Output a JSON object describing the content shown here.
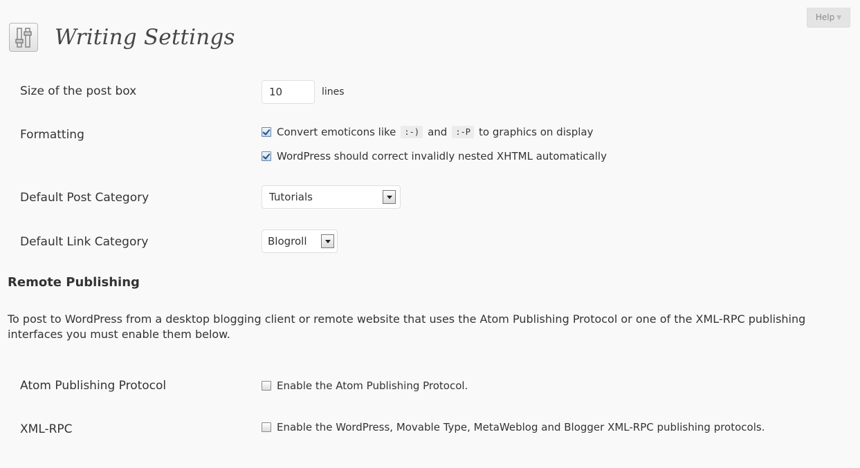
{
  "help": {
    "label": "Help"
  },
  "page": {
    "title": "Writing Settings",
    "icon": "settings-sliders-icon"
  },
  "post_box": {
    "label": "Size of the post box",
    "value": "10",
    "unit": "lines"
  },
  "formatting": {
    "label": "Formatting",
    "emoticons": {
      "checked": true,
      "text_before": "Convert emoticons like",
      "code1": ":-)",
      "text_middle": "and",
      "code2": ":-P",
      "text_after": "to graphics on display"
    },
    "xhtml": {
      "checked": true,
      "label": "WordPress should correct invalidly nested XHTML automatically"
    }
  },
  "default_post_category": {
    "label": "Default Post Category",
    "selected": "Tutorials"
  },
  "default_link_category": {
    "label": "Default Link Category",
    "selected": "Blogroll"
  },
  "remote_publishing": {
    "heading": "Remote Publishing",
    "description": "To post to WordPress from a desktop blogging client or remote website that uses the Atom Publishing Protocol or one of the XML-RPC publishing interfaces you must enable them below.",
    "atom": {
      "label": "Atom Publishing Protocol",
      "checked": false,
      "option": "Enable the Atom Publishing Protocol."
    },
    "xmlrpc": {
      "label": "XML-RPC",
      "checked": false,
      "option": "Enable the WordPress, Movable Type, MetaWeblog and Blogger XML-RPC publishing protocols."
    }
  }
}
